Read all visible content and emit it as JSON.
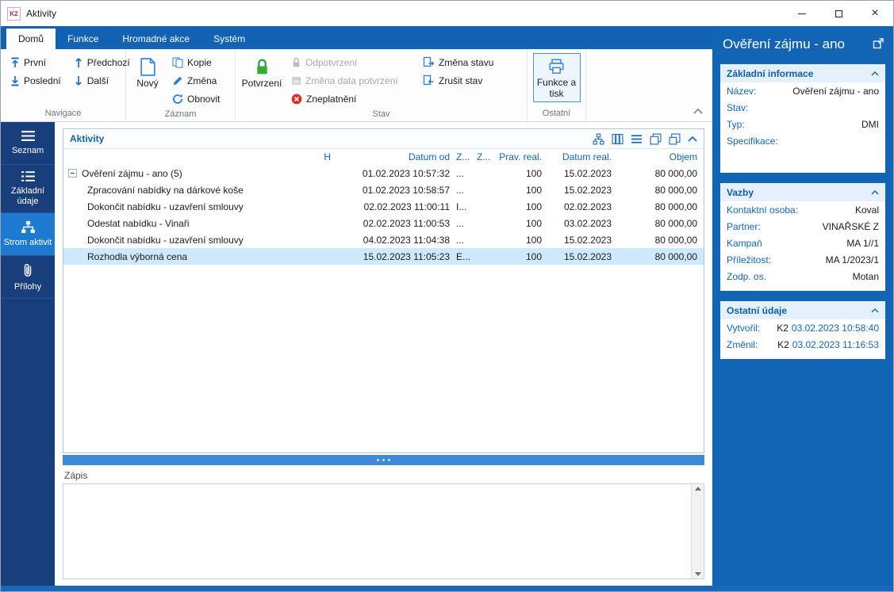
{
  "window": {
    "title": "Aktivity",
    "logo": "K2",
    "controls": {
      "close": "×"
    }
  },
  "colors": {
    "accent_blue": "#1464b4",
    "ribbon_blue": "#1262b4",
    "sidebar_navy": "#193e7c",
    "sidebar_active": "#1e7ad0",
    "selection": "#cde9fb",
    "confirm_green": "#37a83a",
    "invalid_red": "#d93025"
  },
  "ribbon": {
    "tabs": [
      "Domů",
      "Funkce",
      "Hromadné akce",
      "Systém"
    ],
    "nav": {
      "group": "Navigace",
      "first": "První",
      "last": "Poslední",
      "prev": "Předchozí",
      "next": "Další"
    },
    "record": {
      "group": "Záznam",
      "new": "Nový",
      "copy": "Kopie",
      "change": "Změna",
      "refresh": "Obnovit"
    },
    "state": {
      "group": "Stav",
      "confirm": "Potvrzení",
      "unconfirm": "Odpotvrzení",
      "change_date": "Změna data potvrzení",
      "invalidate": "Zneplatnění",
      "change_state": "Změna stavu",
      "cancel_state": "Zrušit stav"
    },
    "other": {
      "group": "Ostatní",
      "functions": "Funkce a tisk"
    }
  },
  "sidebar": {
    "items": [
      {
        "label": "Seznam"
      },
      {
        "label": "Základní údaje"
      },
      {
        "label": "Strom aktivit"
      },
      {
        "label": "Přílohy"
      }
    ]
  },
  "activities": {
    "title": "Aktivity",
    "columns": {
      "h": "H",
      "datum_od": "Datum od",
      "z1": "Z...",
      "z2": "Z...",
      "prav_real": "Prav. real.",
      "datum_real": "Datum real.",
      "objem": "Objem"
    },
    "rows": [
      {
        "name": "Ověření zájmu - ano (5)",
        "datum_od": "01.02.2023 10:57:32",
        "z1": "...",
        "prav_real": "100",
        "datum_real": "15.02.2023",
        "objem": "80 000,00"
      },
      {
        "name": "Zpracování nabídky na dárkové koše",
        "datum_od": "01.02.2023 10:58:57",
        "z1": "...",
        "prav_real": "100",
        "datum_real": "15.02.2023",
        "objem": "80 000,00"
      },
      {
        "name": "Dokončit nabídku - uzavření smlouvy",
        "datum_od": "02.02.2023 11:00:11",
        "z1": "I...",
        "prav_real": "100",
        "datum_real": "02.02.2023",
        "objem": "80 000,00"
      },
      {
        "name": "Odeslat nabídku - Vinaři",
        "datum_od": "02.02.2023 11:00:53",
        "z1": "...",
        "prav_real": "100",
        "datum_real": "03.02.2023",
        "objem": "80 000,00"
      },
      {
        "name": "Dokončit nabídku - uzavření smlouvy",
        "datum_od": "04.02.2023 11:04:38",
        "z1": "...",
        "prav_real": "100",
        "datum_real": "15.02.2023",
        "objem": "80 000,00"
      },
      {
        "name": "Rozhodla výborná cena",
        "datum_od": "15.02.2023 11:05:23",
        "z1": "E...",
        "prav_real": "100",
        "datum_real": "15.02.2023",
        "objem": "80 000,00"
      }
    ]
  },
  "zapis": {
    "label": "Zápis"
  },
  "detail": {
    "title": "Ověření zájmu - ano",
    "basic": {
      "title": "Základní informace",
      "rows": [
        {
          "label": "Název:",
          "value": "Ověření zájmu - ano"
        },
        {
          "label": "Stav:",
          "value": ""
        },
        {
          "label": "Typ:",
          "value": "DMI"
        },
        {
          "label": "Specifikace:",
          "value": ""
        }
      ]
    },
    "vazby": {
      "title": "Vazby",
      "rows": [
        {
          "label": "Kontaktní osoba:",
          "value": "Koval"
        },
        {
          "label": "Partner:",
          "value": "VINAŘSKÉ Z"
        },
        {
          "label": "Kampaň",
          "value": "MA 1//1"
        },
        {
          "label": "Příležitost:",
          "value": "MA 1/2023/1"
        },
        {
          "label": "Zodp. os.",
          "value": "Motan"
        }
      ]
    },
    "ostatni": {
      "title": "Ostatní údaje",
      "rows": [
        {
          "label": "Vytvořil:",
          "user": "K2",
          "link": "03.02.2023 10:58:40"
        },
        {
          "label": "Změnil:",
          "user": "K2",
          "link": "03.02.2023 11:16:53"
        }
      ]
    }
  }
}
